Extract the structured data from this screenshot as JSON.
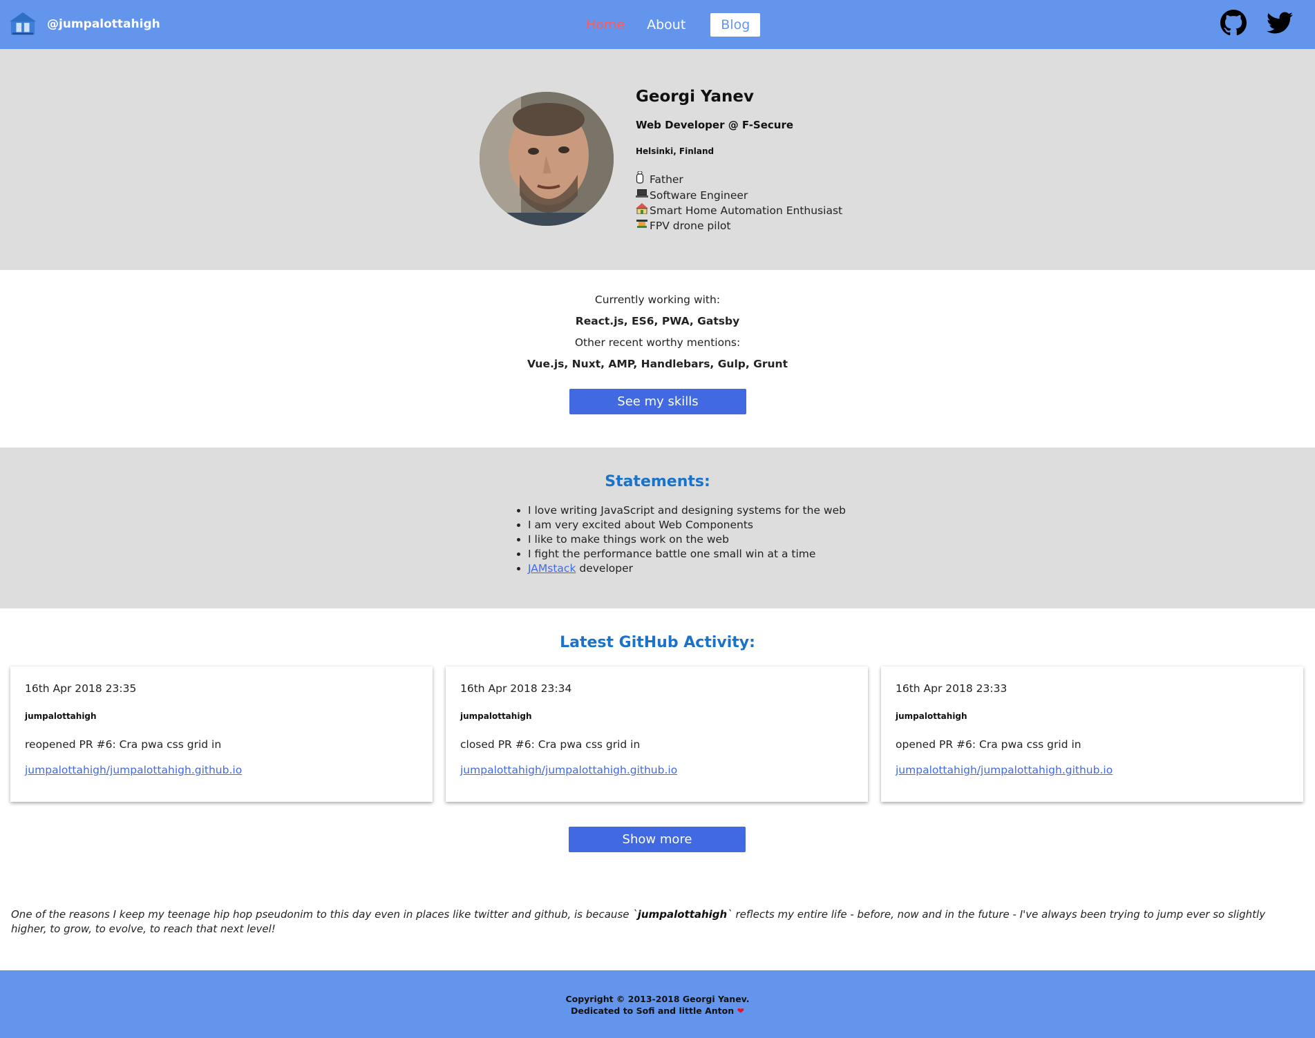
{
  "header": {
    "brand": "@jumpalottahigh",
    "nav": {
      "home": "Home",
      "about": "About",
      "blog": "Blog"
    },
    "social": [
      "github-icon",
      "twitter-icon"
    ],
    "colors": {
      "background": "#6495ed",
      "active": "#ff5a5a"
    }
  },
  "profile": {
    "name": "Georgi Yanev",
    "role": "Web Developer @ F-Secure",
    "location": "Helsinki, Finland",
    "traits": [
      {
        "icon": "baby-bottle-icon",
        "label": "Father"
      },
      {
        "icon": "laptop-icon",
        "label": "Software Engineer"
      },
      {
        "icon": "house-icon",
        "label": "Smart Home Automation Enthusiast"
      },
      {
        "icon": "drone-icon",
        "label": "FPV drone pilot"
      }
    ]
  },
  "skills": {
    "current_label": "Currently working with:",
    "current": "React.js, ES6, PWA, Gatsby",
    "other_label": "Other recent worthy mentions:",
    "other": "Vue.js, Nuxt, AMP, Handlebars, Gulp, Grunt",
    "button": "See my skills"
  },
  "statements": {
    "title": "Statements:",
    "items": [
      "I love writing JavaScript and designing systems for the web",
      "I am very excited about Web Components",
      "I like to make things work on the web",
      "I fight the performance battle one small win at a time"
    ],
    "jamstack": {
      "link": "JAMstack",
      "suffix": " developer"
    }
  },
  "activity": {
    "title": "Latest GitHub Activity:",
    "cards": [
      {
        "date": "16th Apr 2018 23:35",
        "user": "jumpalottahigh",
        "action": "reopened PR #6: Cra pwa css grid in",
        "repo": "jumpalottahigh/jumpalottahigh.github.io"
      },
      {
        "date": "16th Apr 2018 23:34",
        "user": "jumpalottahigh",
        "action": "closed PR #6: Cra pwa css grid in",
        "repo": "jumpalottahigh/jumpalottahigh.github.io"
      },
      {
        "date": "16th Apr 2018 23:33",
        "user": "jumpalottahigh",
        "action": "opened PR #6: Cra pwa css grid in",
        "repo": "jumpalottahigh/jumpalottahigh.github.io"
      }
    ],
    "button": "Show more"
  },
  "quote": {
    "before": "One of the reasons I keep my teenage hip hop pseudonim to this day even in places like twitter and github, is because `",
    "highlight": "jumpalottahigh",
    "after": "` reflects my entire life - before, now and in the future - I've always been trying to jump ever so slightly higher, to grow, to evolve, to reach that next level!"
  },
  "footer": {
    "copyright": "Copyright © 2013-2018 Georgi Yanev.",
    "dedication": "Dedicated to Sofi and little Anton",
    "heart": "❤"
  }
}
